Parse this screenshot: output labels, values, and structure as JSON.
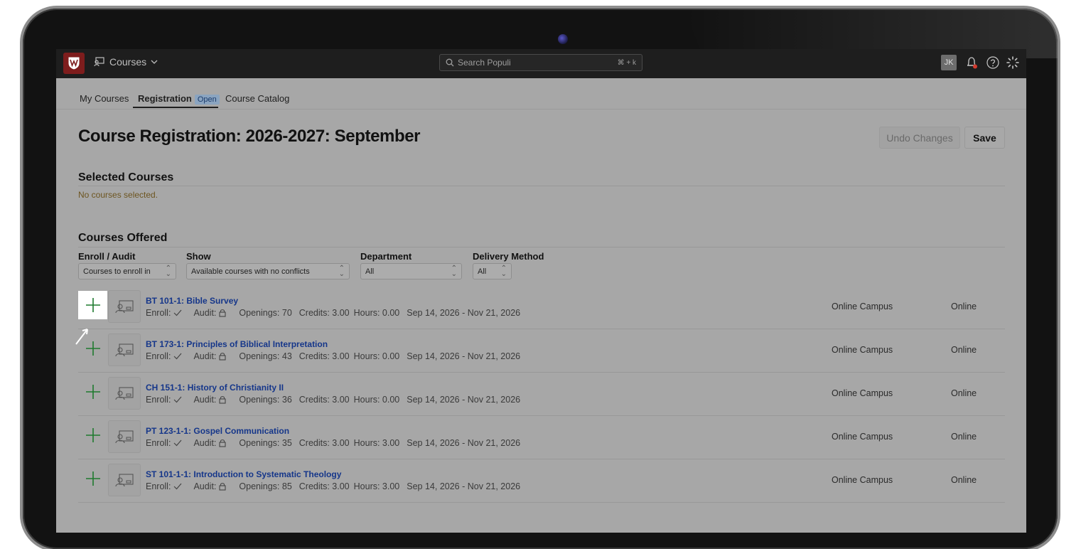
{
  "app": {
    "module_label": "Courses",
    "search_placeholder": "Search Populi",
    "search_shortcut": "⌘ + k",
    "user_initials": "JK",
    "icons": [
      "laptop-chat-icon",
      "chevron-down-icon",
      "search-icon",
      "bell-icon",
      "help-icon",
      "settings-icon"
    ],
    "accent_color": "#15368a",
    "add_color": "#1e7a2e"
  },
  "tabs": [
    {
      "label": "My Courses"
    },
    {
      "label": "Registration",
      "badge": "Open"
    },
    {
      "label": "Course Catalog"
    }
  ],
  "page": {
    "title": "Course Registration: 2026-2027: September",
    "undo_label": "Undo Changes",
    "save_label": "Save"
  },
  "selected": {
    "title": "Selected Courses",
    "empty_text": "No courses selected."
  },
  "offered": {
    "title": "Courses Offered",
    "filters": [
      {
        "label": "Enroll / Audit",
        "value": "Courses to enroll in"
      },
      {
        "label": "Show",
        "value": "Available courses with no conflicts"
      },
      {
        "label": "Department",
        "value": "All"
      },
      {
        "label": "Delivery Method",
        "value": "All"
      }
    ],
    "courses": [
      {
        "name": "BT 101-1: Bible Survey",
        "enroll": "Enroll:",
        "audit": "Audit:",
        "openings": "Openings: 70",
        "credits": "Credits: 3.00",
        "hours": "Hours: 0.00",
        "dates": "Sep 14, 2026 - Nov 21, 2026",
        "campus": "Online Campus",
        "method": "Online"
      },
      {
        "name": "BT 173-1: Principles of Biblical Interpretation",
        "enroll": "Enroll:",
        "audit": "Audit:",
        "openings": "Openings: 43",
        "credits": "Credits: 3.00",
        "hours": "Hours: 0.00",
        "dates": "Sep 14, 2026 - Nov 21, 2026",
        "campus": "Online Campus",
        "method": "Online"
      },
      {
        "name": "CH 151-1: History of Christianity II",
        "enroll": "Enroll:",
        "audit": "Audit:",
        "openings": "Openings: 36",
        "credits": "Credits: 3.00",
        "hours": "Hours: 0.00",
        "dates": "Sep 14, 2026 - Nov 21, 2026",
        "campus": "Online Campus",
        "method": "Online"
      },
      {
        "name": "PT 123-1-1: Gospel Communication",
        "enroll": "Enroll:",
        "audit": "Audit:",
        "openings": "Openings: 35",
        "credits": "Credits: 3.00",
        "hours": "Hours: 3.00",
        "dates": "Sep 14, 2026 - Nov 21, 2026",
        "campus": "Online Campus",
        "method": "Online"
      },
      {
        "name": "ST 101-1-1: Introduction to Systematic Theology",
        "enroll": "Enroll:",
        "audit": "Audit:",
        "openings": "Openings: 85",
        "credits": "Credits: 3.00",
        "hours": "Hours: 3.00",
        "dates": "Sep 14, 2026 - Nov 21, 2026",
        "campus": "Online Campus",
        "method": "Online"
      }
    ]
  }
}
